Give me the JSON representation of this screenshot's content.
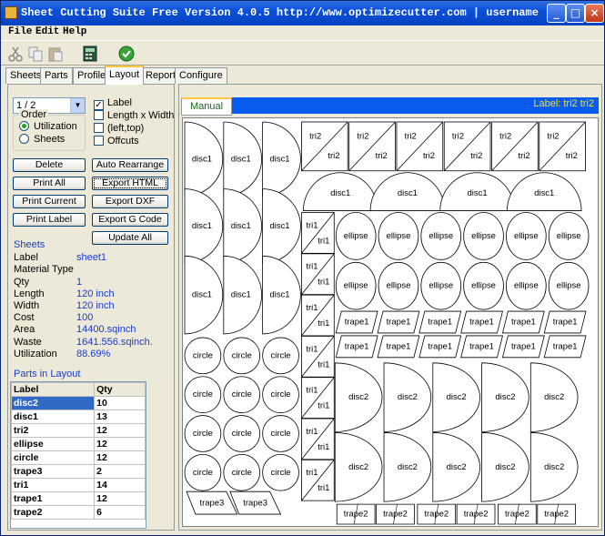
{
  "window": {
    "title": "Sheet Cutting Suite Free Version  4.0.5 http://www.optimizecutter.com | username :...",
    "controls": [
      "_",
      "□",
      "×"
    ]
  },
  "menu": [
    "File",
    "Edit",
    "Help"
  ],
  "toolbar": {
    "icons": [
      "cut-icon",
      "copy-icon",
      "paste-icon",
      "calculator-icon",
      "run-icon"
    ]
  },
  "tabs": [
    "Sheets",
    "Parts",
    "Profile",
    "Layout",
    "Report",
    "Configure"
  ],
  "active_tab": "Layout",
  "left": {
    "sheet_select": "1 / 2",
    "options": [
      {
        "label": "Label",
        "checked": true
      },
      {
        "label": "Length x Width",
        "checked": false
      },
      {
        "label": "(left,top)",
        "checked": false
      },
      {
        "label": "Offcuts",
        "checked": false
      }
    ],
    "order": {
      "title": "Order",
      "items": [
        {
          "label": "Utilization",
          "selected": true
        },
        {
          "label": "Sheets",
          "selected": false
        }
      ]
    },
    "buttons": {
      "delete": "Delete",
      "auto_rearrange": "Auto Rearrange",
      "print_all": "Print All",
      "export_html": "Export HTML",
      "print_current": "Print Current",
      "export_dxf": "Export DXF",
      "print_label": "Print Label",
      "export_gcode": "Export G Code",
      "update_all": "Update All"
    },
    "sheets_title": "Sheets",
    "props": [
      {
        "label": "Label",
        "value": "sheet1"
      },
      {
        "label": "Material Type",
        "value": ""
      },
      {
        "label": "Qty",
        "value": "1"
      },
      {
        "label": "Length",
        "value": "120 inch"
      },
      {
        "label": "Width",
        "value": "120 inch"
      },
      {
        "label": "Cost",
        "value": "100"
      },
      {
        "label": "Area",
        "value": "14400.sqinch"
      },
      {
        "label": "Waste",
        "value": "1641.556.sqinch."
      },
      {
        "label": "Utilization",
        "value": "88.69%"
      }
    ],
    "parts_title": "Parts in Layout",
    "parts_header": [
      "Label",
      "Qty"
    ],
    "parts": [
      [
        "disc2",
        "10"
      ],
      [
        "disc1",
        "13"
      ],
      [
        "tri2",
        "12"
      ],
      [
        "ellipse",
        "12"
      ],
      [
        "circle",
        "12"
      ],
      [
        "trape3",
        "2"
      ],
      [
        "tri1",
        "14"
      ],
      [
        "trape1",
        "12"
      ],
      [
        "trape2",
        "6"
      ]
    ]
  },
  "right": {
    "manual_tab": "Manual",
    "status_label": "Label: tri2  tri2",
    "parts": {
      "disc1": "disc1",
      "disc2": "disc2",
      "tri1": "tri1",
      "tri2": "tri2",
      "ellipse": "ellipse",
      "circle": "circle",
      "trape1": "trape1",
      "trape2": "trape2",
      "trape3": "trape3"
    }
  },
  "colors": {
    "titlebar": "#0a4fd8",
    "accent_blue": "#0a5bf0",
    "label_yellow": "#ffe400",
    "value_blue": "#1a3cc8",
    "selection": "#316ac5"
  }
}
